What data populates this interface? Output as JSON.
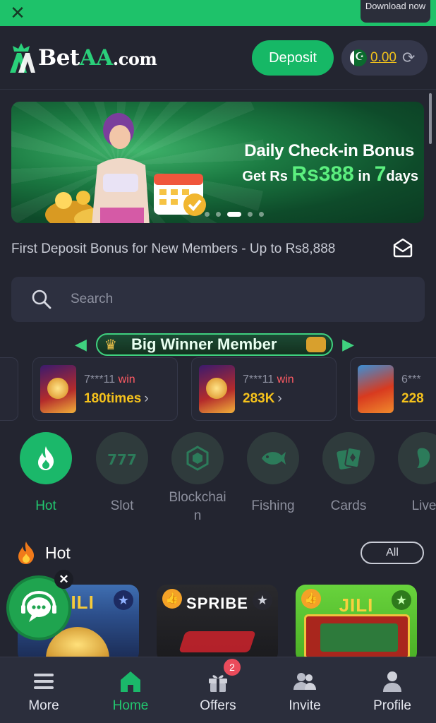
{
  "topbar": {
    "close_icon": "close-icon",
    "download_label": "Download now"
  },
  "header": {
    "logo_text_main": "Bet",
    "logo_text_accent": "AA",
    "logo_text_suffix": ".com",
    "deposit_label": "Deposit",
    "balance": "0.00",
    "flag_icon": "pakistan-flag-icon",
    "refresh_icon": "refresh-icon"
  },
  "banner": {
    "line1": "Daily Check-in Bonus",
    "line2_prefix": "Get Rs ",
    "line2_amount": "Rs388",
    "line2_middle": " in ",
    "line2_days_num": "7",
    "line2_days": "days",
    "active_slide": 3,
    "slides": 5
  },
  "marquee": {
    "text": "First Deposit Bonus for New Members - Up to Rs8,888",
    "icon": "mail-icon"
  },
  "search": {
    "placeholder": "Search",
    "icon": "search-icon"
  },
  "winners": {
    "title": "Big Winner Member",
    "items": [
      {
        "user": "7***11",
        "win_word": "win",
        "amount": "180times"
      },
      {
        "user": "7***11",
        "win_word": "win",
        "amount": "283K"
      },
      {
        "user": "6***",
        "win_word": "",
        "amount": "228"
      }
    ]
  },
  "categories": [
    {
      "label": "Hot",
      "icon": "flame-icon",
      "active": true
    },
    {
      "label": "Slot",
      "icon": "slot-777-icon",
      "active": false
    },
    {
      "label": "Blockchai\nn",
      "icon": "blockchain-cube-icon",
      "active": false
    },
    {
      "label": "Fishing",
      "icon": "fish-icon",
      "active": false
    },
    {
      "label": "Cards",
      "icon": "cards-icon",
      "active": false
    },
    {
      "label": "Live",
      "icon": "live-dealer-icon",
      "active": false
    }
  ],
  "hot": {
    "title": "Hot",
    "all_label": "All",
    "games": [
      {
        "name": "JILI",
        "provider_icon": "star-icon"
      },
      {
        "name": "SPRIBE",
        "provider_icon": "star-icon"
      },
      {
        "name": "JILI",
        "provider_icon": "star-icon"
      }
    ]
  },
  "chat": {
    "icon": "customer-support-chat-icon",
    "close_icon": "close-icon"
  },
  "bottom_nav": [
    {
      "label": "More",
      "icon": "menu-icon",
      "active": false
    },
    {
      "label": "Home",
      "icon": "home-icon",
      "active": true
    },
    {
      "label": "Offers",
      "icon": "gift-icon",
      "active": false,
      "badge": "2"
    },
    {
      "label": "Invite",
      "icon": "invite-users-icon",
      "active": false
    },
    {
      "label": "Profile",
      "icon": "profile-icon",
      "active": false
    }
  ],
  "colors": {
    "brand_green": "#1bb86a",
    "background": "#232530",
    "gold": "#f5c21c",
    "win_red": "#ff5b64"
  }
}
